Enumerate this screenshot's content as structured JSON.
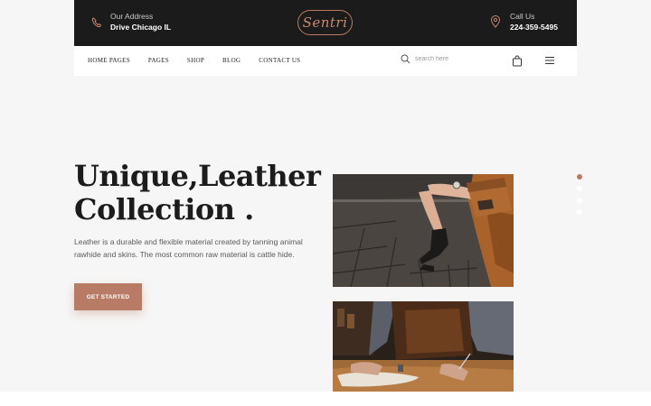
{
  "topbar": {
    "address_label": "Our Address",
    "address_value": "Drive Chicago IL",
    "logo_text": "Sentri",
    "call_label": "Call Us",
    "call_value": "224-359-5495"
  },
  "nav": {
    "items": [
      "HOME PAGES",
      "PAGES",
      "SHOP",
      "BLOG",
      "CONTACT US"
    ]
  },
  "search": {
    "placeholder": "search here"
  },
  "hero": {
    "headline_line1": "Unique,Leather",
    "headline_line2": "Collection .",
    "description": "Leather is a durable and flexible material created by tanning animal rawhide and skins. The most common raw material is cattle hide.",
    "cta_label": "GET STARTED"
  },
  "slider": {
    "dot_count": 4,
    "active_index": 0
  },
  "colors": {
    "accent": "#b77b66",
    "dark": "#1b1b1b",
    "background": "#f6f6f6"
  },
  "icons": {
    "address": "phone-icon",
    "call": "location-pin-icon",
    "search": "search-icon",
    "cart": "shopping-bag-icon",
    "menu": "hamburger-menu-icon"
  }
}
